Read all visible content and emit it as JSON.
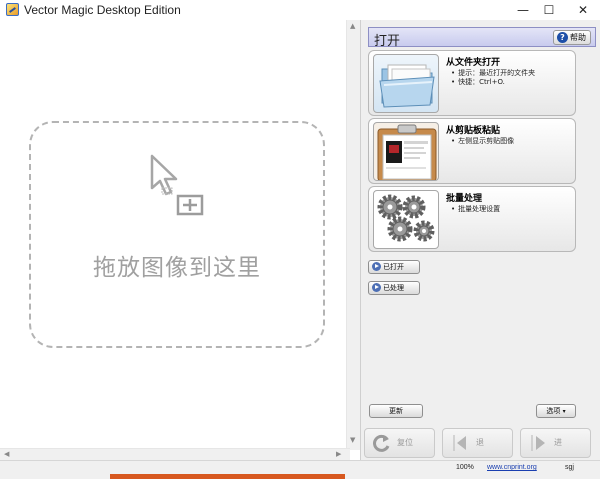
{
  "window": {
    "title": "Vector Magic Desktop Edition",
    "controls": {
      "minimize": "—",
      "maximize": "☐",
      "close": "✕"
    }
  },
  "canvas": {
    "drop_text": "拖放图像到这里",
    "drop_icon": "cursor-add-icon"
  },
  "panel": {
    "title": "打开",
    "help_label": "帮助",
    "cards": [
      {
        "title": "从文件夹打开",
        "lines": [
          "提示：最近打开的文件夹",
          "快捷：Ctrl+O."
        ],
        "icon": "folder-icon"
      },
      {
        "title": "从剪贴板粘贴",
        "lines": [
          "左侧显示剪贴图像"
        ],
        "icon": "clipboard-icon"
      },
      {
        "title": "批量处理",
        "lines": [
          "批量处理设置"
        ],
        "icon": "gears-icon"
      }
    ],
    "expanders": {
      "opened": "已打开",
      "processed": "已处理"
    },
    "update_label": "更新",
    "options_label": "选项",
    "nav": {
      "back": "复位",
      "prev": "退",
      "next": "进"
    }
  },
  "status": {
    "zoom": "100%",
    "link": "www.cnprint.org",
    "user": "sgj"
  },
  "colors": {
    "panel_header_border": "#8d8fc4",
    "panel_header_bg": "#c8cbee",
    "drop_border": "#b4b4b4",
    "link": "#1a3fb0",
    "orange_strip": "#d7581f"
  }
}
